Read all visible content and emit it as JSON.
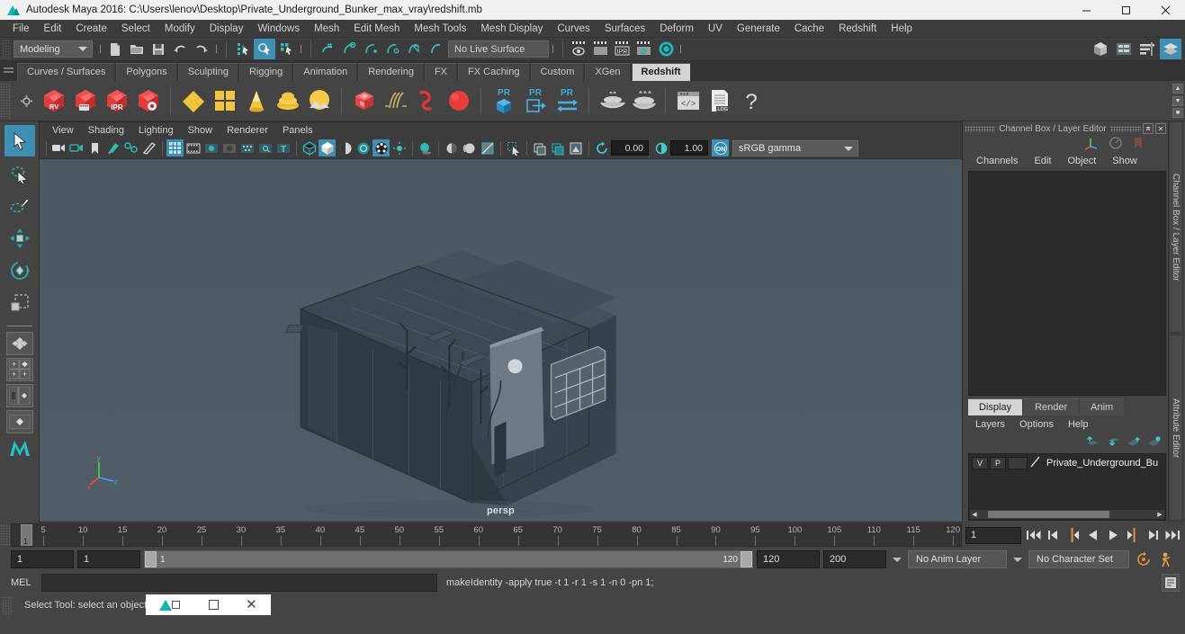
{
  "titlebar": {
    "title": "Autodesk Maya 2016: C:\\Users\\lenov\\Desktop\\Private_Underground_Bunker_max_vray\\redshift.mb",
    "minimize": "─",
    "maximize": "❐",
    "close": "✕"
  },
  "menubar": {
    "items": [
      {
        "label": "File"
      },
      {
        "label": "Edit"
      },
      {
        "label": "Create"
      },
      {
        "label": "Select"
      },
      {
        "label": "Modify"
      },
      {
        "label": "Display"
      },
      {
        "label": "Windows"
      },
      {
        "label": "Mesh"
      },
      {
        "label": "Edit Mesh"
      },
      {
        "label": "Mesh Tools"
      },
      {
        "label": "Mesh Display"
      },
      {
        "label": "Curves"
      },
      {
        "label": "Surfaces"
      },
      {
        "label": "Deform"
      },
      {
        "label": "UV"
      },
      {
        "label": "Generate"
      },
      {
        "label": "Cache"
      },
      {
        "label": "Redshift"
      },
      {
        "label": "Help"
      }
    ]
  },
  "statusline": {
    "menu_set": "Modeling",
    "live_surface": "No Live Surface"
  },
  "shelf": {
    "tabs": [
      {
        "label": "Curves / Surfaces",
        "active": false
      },
      {
        "label": "Polygons",
        "active": false
      },
      {
        "label": "Sculpting",
        "active": false
      },
      {
        "label": "Rigging",
        "active": false
      },
      {
        "label": "Animation",
        "active": false
      },
      {
        "label": "Rendering",
        "active": false
      },
      {
        "label": "FX",
        "active": false
      },
      {
        "label": "FX Caching",
        "active": false
      },
      {
        "label": "Custom",
        "active": false
      },
      {
        "label": "XGen",
        "active": false
      },
      {
        "label": "Redshift",
        "active": true
      }
    ],
    "badges": {
      "rv": "RV",
      "ipr": "IPR",
      "pr": "PR",
      "log": ".LOG",
      "code": "</>",
      "help": "?"
    }
  },
  "viewport": {
    "menus": [
      "View",
      "Shading",
      "Lighting",
      "Show",
      "Renderer",
      "Panels"
    ],
    "exposure": "0.00",
    "gamma_value": "1.00",
    "color_profile": "sRGB gamma",
    "camera_label": "persp",
    "axis": {
      "x": "x",
      "y": "y",
      "z": "z"
    }
  },
  "channelbox": {
    "panel_title": "Channel Box / Layer Editor",
    "menus": [
      "Channels",
      "Edit",
      "Object",
      "Show"
    ],
    "vertical_tabs": [
      "Channel Box / Layer Editor",
      "Attribute Editor"
    ]
  },
  "layereditor": {
    "tabs": [
      {
        "label": "Display",
        "active": true
      },
      {
        "label": "Render",
        "active": false
      },
      {
        "label": "Anim",
        "active": false
      }
    ],
    "menus": [
      "Layers",
      "Options",
      "Help"
    ],
    "layers": [
      {
        "visible": "V",
        "playback": "P",
        "type": "",
        "name": "Private_Underground_Bu"
      }
    ]
  },
  "timeslider": {
    "current_frame": "1",
    "ticks": [
      5,
      10,
      15,
      20,
      25,
      30,
      35,
      40,
      45,
      50,
      55,
      60,
      65,
      70,
      75,
      80,
      85,
      90,
      95,
      100,
      105,
      110,
      115,
      120
    ],
    "range_start": 1,
    "range_end": 120,
    "frame_field": "1"
  },
  "rangeslider": {
    "anim_start": "1",
    "playback_start": "1",
    "bar_start_label": "1",
    "bar_end_label": "120",
    "playback_end": "120",
    "anim_end": "200",
    "anim_layer": "No Anim Layer",
    "character_set": "No Character Set"
  },
  "commandline": {
    "label": "MEL",
    "input_value": "",
    "output": "makeIdentity -apply true -t 1 -r 1 -s 1 -n 0 -pn 1;"
  },
  "statusbar": {
    "help_text": "Select Tool: select an object"
  },
  "colors": {
    "accent_blue": "#3f8fb5",
    "panel_bg": "#444444",
    "viewport_bg": "#4e5a63",
    "teal": "#27b3b3",
    "shelf_red": "#e03b3b",
    "shelf_yellow": "#f0c330",
    "orange": "#e08a34"
  }
}
